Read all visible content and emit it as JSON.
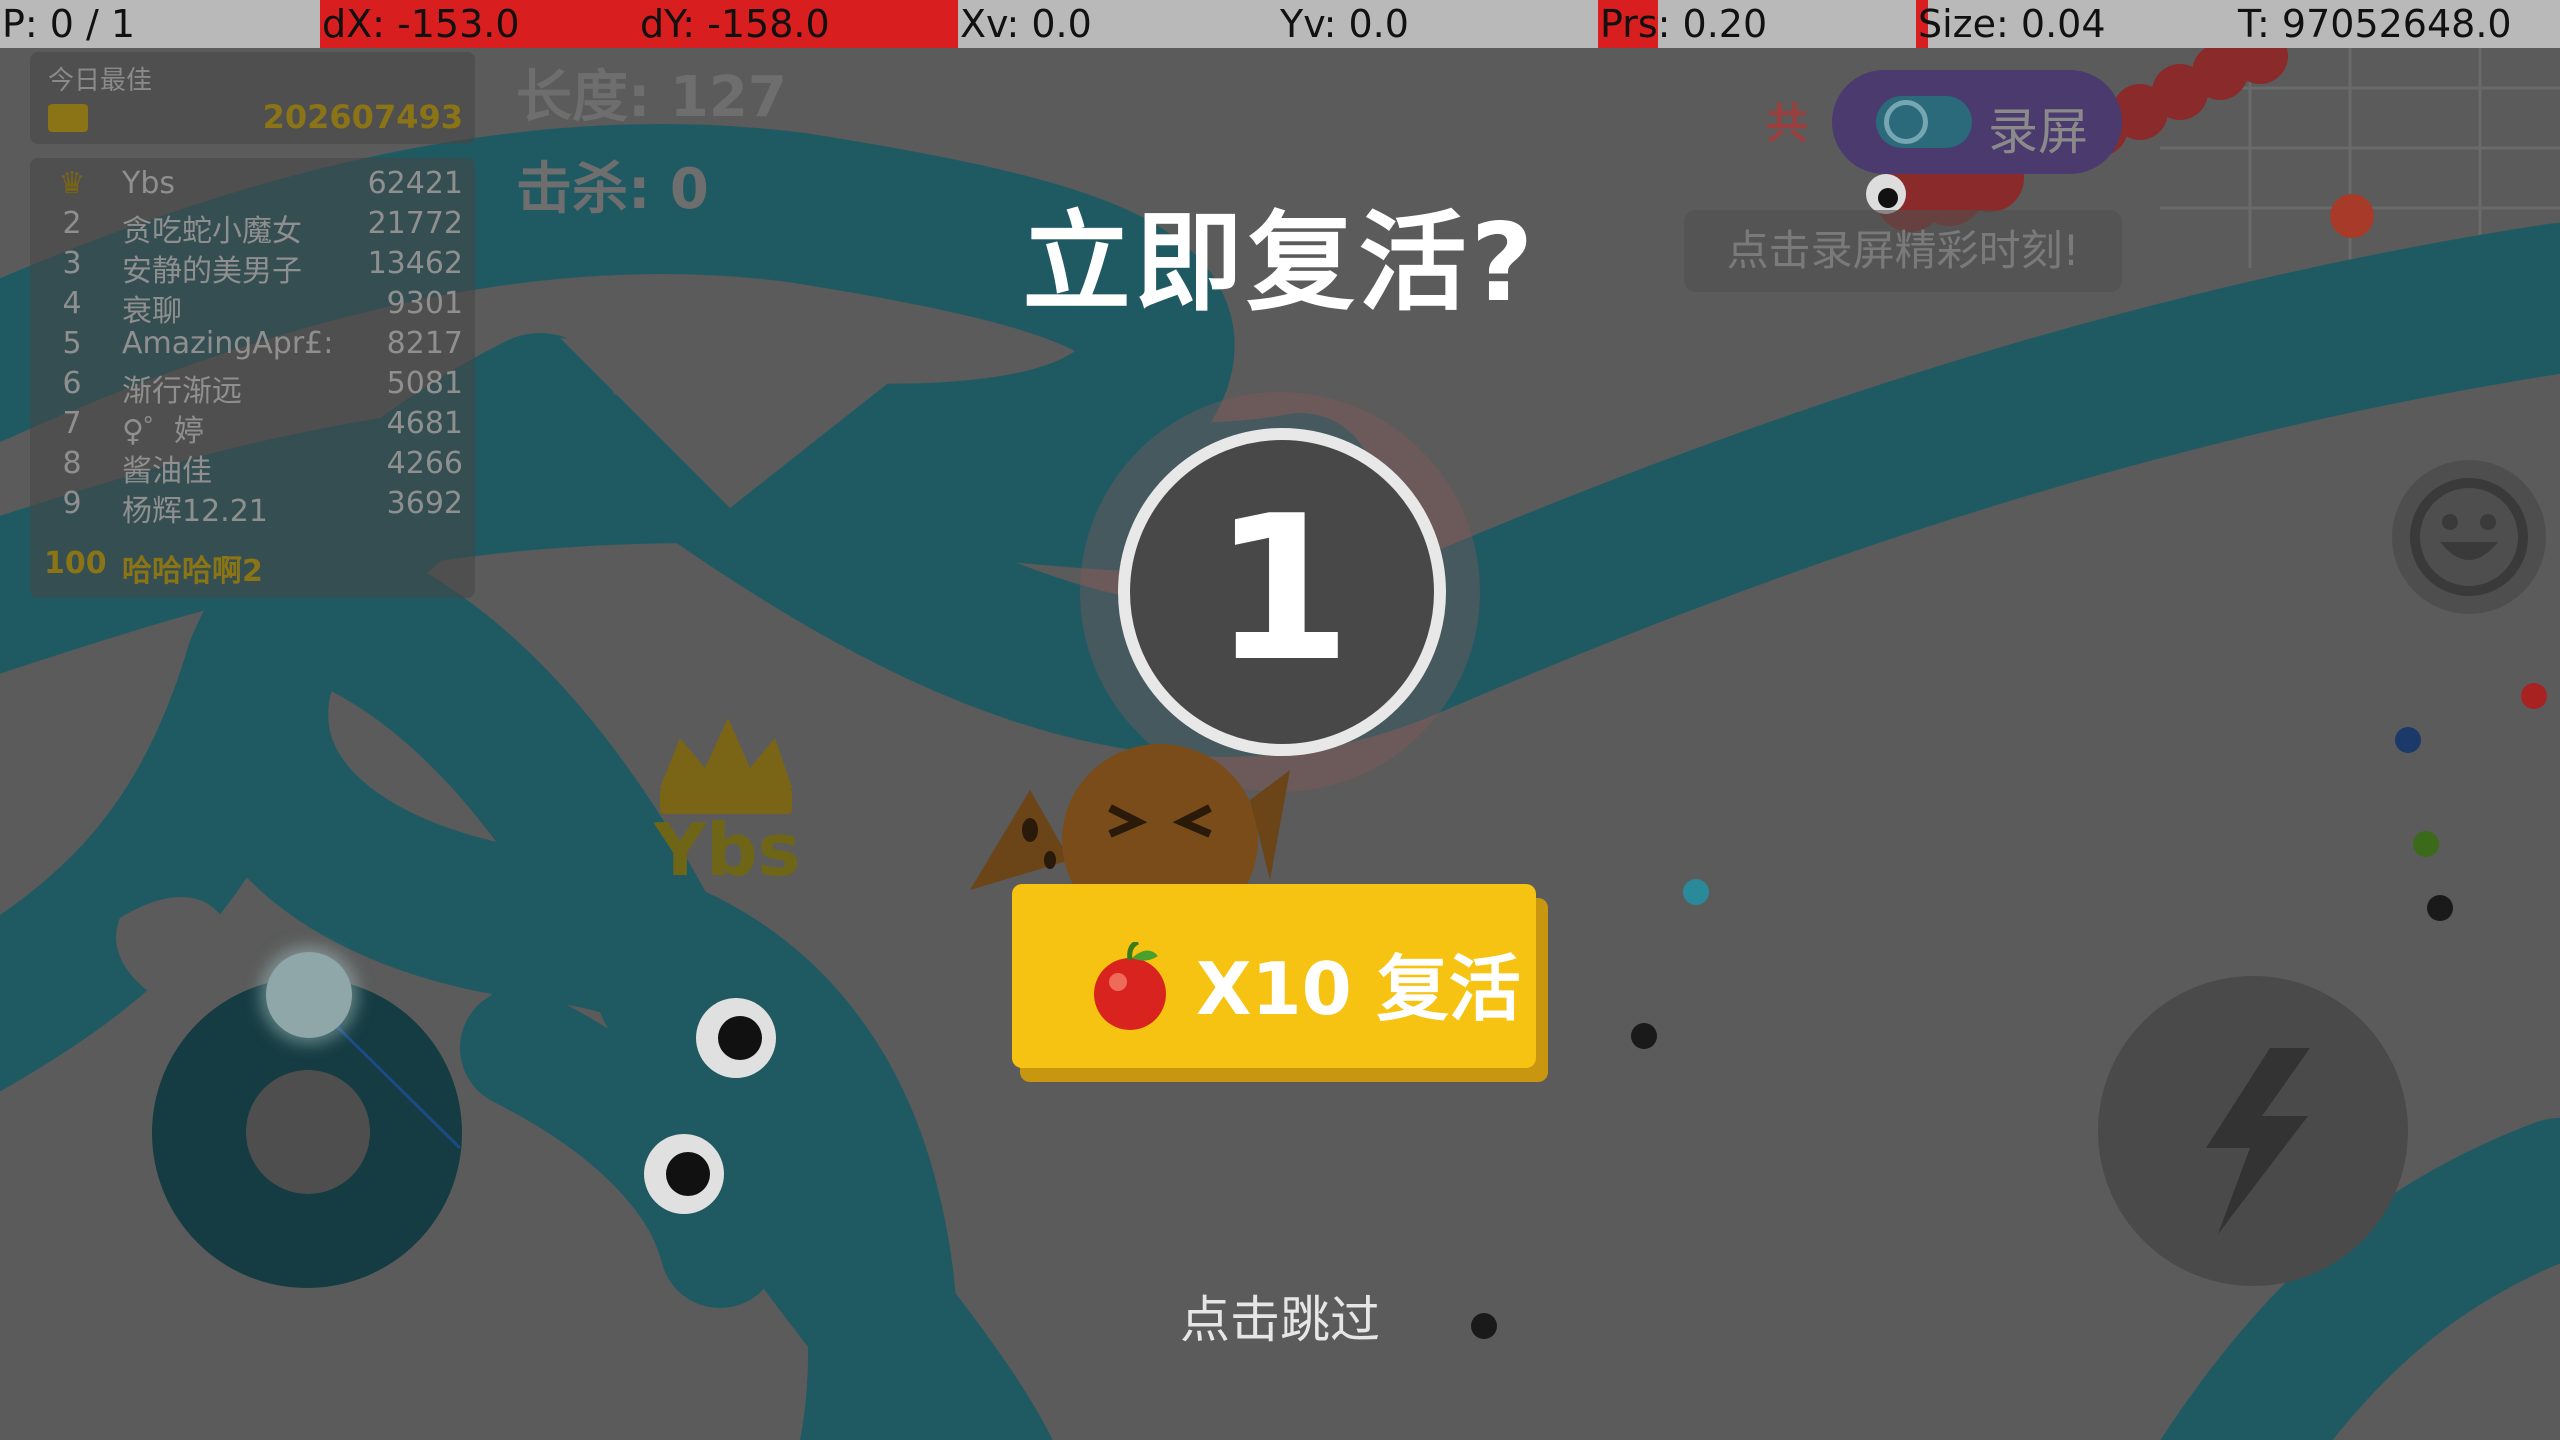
{
  "debug": {
    "pointer": "P: 0 / 1",
    "dx": "dX: -153.0",
    "dy": "dY: -158.0",
    "xv": "Xv: 0.0",
    "yv": "Yv: 0.0",
    "prs": "Prs: 0.20",
    "size": "Size: 0.04",
    "time": "T: 97052648.0"
  },
  "daily_best": {
    "label": "今日最佳",
    "value": "202607493"
  },
  "leaderboard": [
    {
      "rank": "1",
      "name": "Ybs",
      "score": "62421"
    },
    {
      "rank": "2",
      "name": "贪吃蛇小魔女",
      "score": "21772"
    },
    {
      "rank": "3",
      "name": "安静的美男子",
      "score": "13462"
    },
    {
      "rank": "4",
      "name": "衰聊",
      "score": "9301"
    },
    {
      "rank": "5",
      "name": "AmazingApr£:",
      "score": "8217"
    },
    {
      "rank": "6",
      "name": "渐行渐远",
      "score": "5081"
    },
    {
      "rank": "7",
      "name": "♀゜婷",
      "score": "4681"
    },
    {
      "rank": "8",
      "name": "酱油佳",
      "score": "4266"
    },
    {
      "rank": "9",
      "name": "杨辉12.21",
      "score": "3692"
    }
  ],
  "my_rank": {
    "rank": "100",
    "name": "哈哈哈啊2",
    "score": ""
  },
  "stats": {
    "length_label": "长度: ",
    "length": "127",
    "kills_label": "击杀: ",
    "kills": "0"
  },
  "revive": {
    "title": "立即复活?",
    "countdown": "1",
    "button_label": "X10 复活",
    "skip_label": "点击跳过"
  },
  "record": {
    "label": "录屏",
    "hint": "点击录屏精彩时刻!",
    "share": "共"
  },
  "player_name": "Ybs",
  "icons": [
    "apple-icon",
    "crown-icon",
    "emoji-icon",
    "lightning-icon"
  ],
  "colors": {
    "background": "#5b5b5b",
    "snake": "#1f5a63",
    "revive_button": "#f7c313",
    "debug_red": "#d81e1e"
  }
}
